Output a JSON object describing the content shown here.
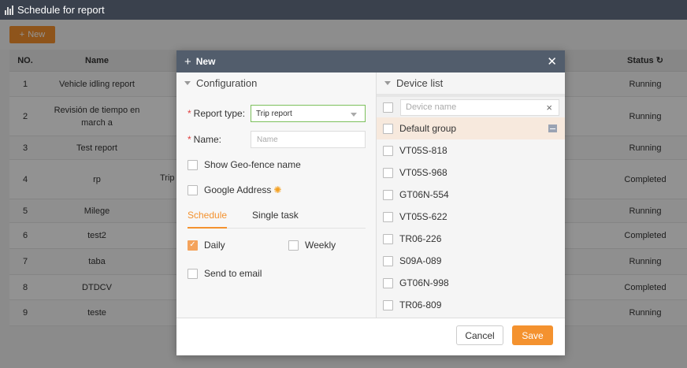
{
  "app": {
    "title": "Schedule for report"
  },
  "toolbar": {
    "new_label": "New"
  },
  "table": {
    "headers": {
      "no": "NO.",
      "name": "Name",
      "status": "Status"
    },
    "peek_text": "Trip",
    "rows": [
      {
        "no": "1",
        "name": "Vehicle idling report",
        "status": "Running"
      },
      {
        "no": "2",
        "name": "Revisión de tiempo en march a",
        "status": "Running"
      },
      {
        "no": "3",
        "name": "Test report",
        "status": "Running"
      },
      {
        "no": "4",
        "name": "rp",
        "status": "Completed"
      },
      {
        "no": "5",
        "name": "Milege",
        "status": "Running"
      },
      {
        "no": "6",
        "name": "test2",
        "status": "Completed"
      },
      {
        "no": "7",
        "name": "taba",
        "status": "Running"
      },
      {
        "no": "8",
        "name": "DTDCV",
        "status": "Completed"
      },
      {
        "no": "9",
        "name": "teste",
        "status": "Running"
      }
    ]
  },
  "modal": {
    "title": "New",
    "configuration": {
      "heading": "Configuration",
      "report_type_label": "Report type:",
      "report_type_value": "Trip report",
      "name_label": "Name:",
      "name_placeholder": "Name",
      "show_geofence": "Show Geo-fence name",
      "google_address": "Google Address",
      "tabs": [
        "Schedule",
        "Single task"
      ],
      "daily": "Daily",
      "weekly": "Weekly",
      "send_email": "Send to email"
    },
    "device_list": {
      "heading": "Device list",
      "search_placeholder": "Device name",
      "group": "Default group",
      "devices": [
        "VT05S-818",
        "VT05S-968",
        "GT06N-554",
        "VT05S-622",
        "TR06-226",
        "S09A-089",
        "GT06N-998",
        "TR06-809"
      ]
    },
    "cancel_label": "Cancel",
    "save_label": "Save"
  },
  "colors": {
    "accent": "#f4922f",
    "header": "#525d6c",
    "titlebar": "#3a414d"
  }
}
